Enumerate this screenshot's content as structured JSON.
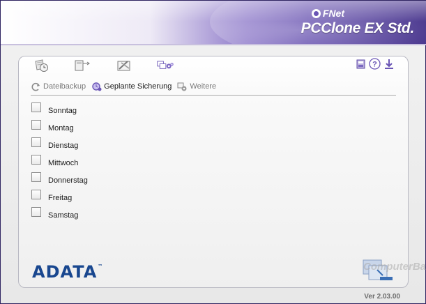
{
  "header": {
    "vendor": "FNet",
    "product": "PCClone EX Std."
  },
  "toolbar": {
    "icons": [
      "clock-disk-icon",
      "restore-arrow-icon",
      "tools-icon",
      "settings-gears-icon"
    ],
    "right_icons": [
      "disk-drive-icon",
      "help-icon",
      "download-icon"
    ],
    "help_glyph": "?"
  },
  "subnav": {
    "items": [
      {
        "label": "Dateibackup",
        "active": false
      },
      {
        "label": "Geplante Sicherung",
        "active": true
      },
      {
        "label": "Weitere",
        "active": false
      }
    ]
  },
  "schedule": {
    "days": [
      {
        "label": "Sonntag",
        "checked": false
      },
      {
        "label": "Montag",
        "checked": false
      },
      {
        "label": "Dienstag",
        "checked": false
      },
      {
        "label": "Mittwoch",
        "checked": false
      },
      {
        "label": "Donnerstag",
        "checked": false
      },
      {
        "label": "Freitag",
        "checked": false
      },
      {
        "label": "Samstag",
        "checked": false
      }
    ]
  },
  "footer": {
    "logo": "ADATA",
    "logo_mark": "™",
    "watermark": "ComputerBase",
    "version": "Ver 2.03.00"
  },
  "colors": {
    "title_purple": "#3e2a86",
    "accent_purple": "#6a55b5",
    "logo_blue": "#19478f"
  }
}
